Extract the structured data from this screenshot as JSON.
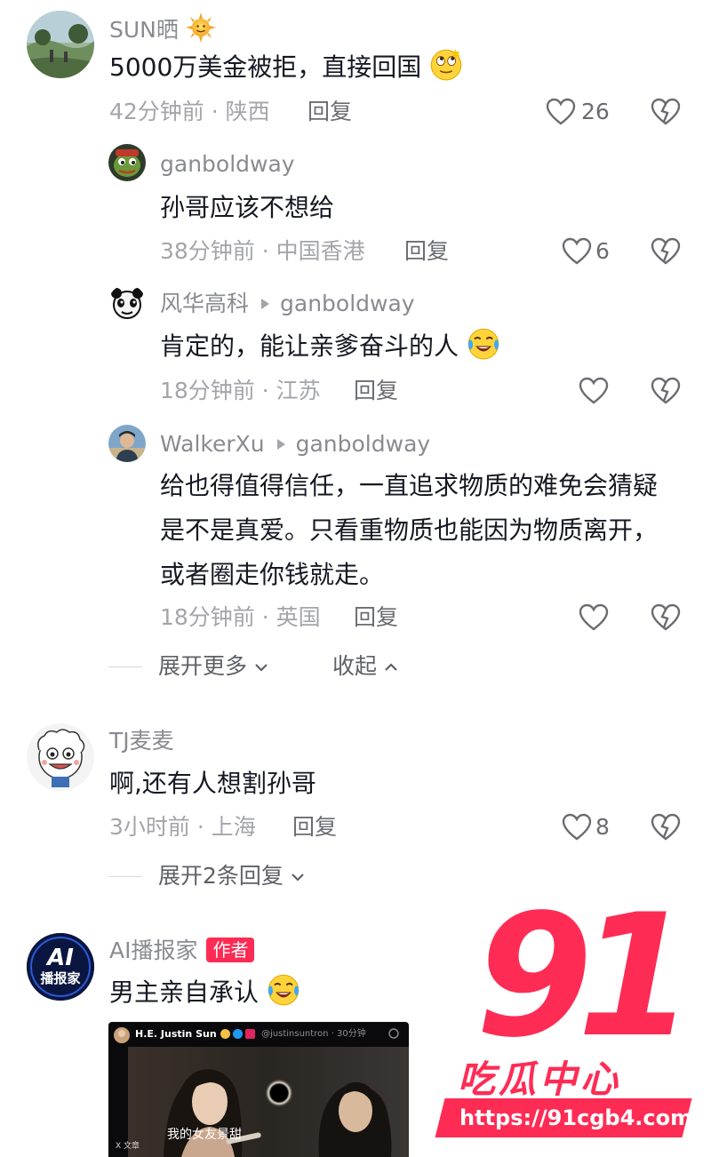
{
  "comments": [
    {
      "user": "SUN晒",
      "text": "5000万美金被拒，直接回国",
      "time_location": "42分钟前 · 陕西",
      "reply_label": "回复",
      "likes": "26"
    },
    {
      "user": "ganboldway",
      "text": "孙哥应该不想给",
      "time_location": "38分钟前 · 中国香港",
      "reply_label": "回复",
      "likes": "6"
    },
    {
      "user": "风华高科",
      "reply_to": "ganboldway",
      "text": "肯定的，能让亲爹奋斗的人",
      "time_location": "18分钟前 · 江苏",
      "reply_label": "回复",
      "likes": ""
    },
    {
      "user": "WalkerXu",
      "reply_to": "ganboldway",
      "text": "给也得值得信任，一直追求物质的难免会猜疑是不是真爱。只看重物质也能因为物质离开，或者圈走你钱就走。",
      "time_location": "18分钟前 · 英国",
      "reply_label": "回复",
      "likes": ""
    },
    {
      "user": "TJ麦麦",
      "text": "啊,还有人想割孙哥",
      "time_location": "3小时前 · 上海",
      "reply_label": "回复",
      "likes": "8"
    },
    {
      "user": "AI播报家",
      "badge": "作者",
      "text": "男主亲自承认"
    }
  ],
  "thread_controls": {
    "expand_more": "展开更多",
    "collapse": "收起",
    "expand_replies": "展开2条回复"
  },
  "embedded_post": {
    "author": "H.E. Justin Sun",
    "handle": "@justinsuntron · 30分钟",
    "caption": "我的女友景甜",
    "corner_label": "X 文章"
  },
  "avatars": {
    "ai_reporter_logo": "AI",
    "ai_reporter_sub": "播报家"
  },
  "watermark": {
    "number": "91",
    "title": "吃瓜中心",
    "url": "https://91cgb4.com"
  },
  "colors": {
    "accent": "#fe2c55",
    "muted": "#a4a5aa"
  }
}
